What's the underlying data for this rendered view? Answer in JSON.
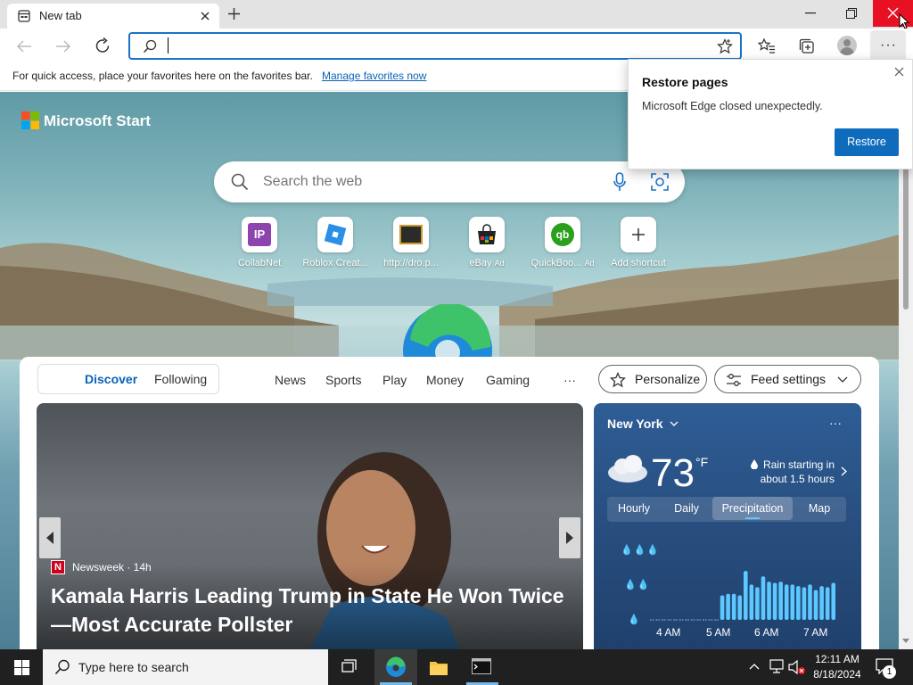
{
  "browser": {
    "tab_title": "New tab",
    "address_value": "",
    "favorites_bar_text": "For quick access, place your favorites here on the favorites bar.",
    "favorites_bar_link": "Manage favorites now"
  },
  "popup": {
    "title": "Restore pages",
    "message": "Microsoft Edge closed unexpectedly.",
    "restore_label": "Restore"
  },
  "start": {
    "brand": "Microsoft Start",
    "search_placeholder": "Search the web",
    "shortcuts": [
      {
        "label": "CollabNet",
        "icon": "collabnet-icon",
        "ad": ""
      },
      {
        "label": "Roblox Creat...",
        "icon": "roblox-icon",
        "ad": ""
      },
      {
        "label": "http://dro.p...",
        "icon": "dropbox-like-icon",
        "ad": ""
      },
      {
        "label": "eBay",
        "icon": "ebay-icon",
        "ad": "Ad"
      },
      {
        "label": "QuickBoo...",
        "icon": "quickbooks-icon",
        "ad": "Ad"
      },
      {
        "label": "Add shortcut",
        "icon": "plus-icon",
        "ad": ""
      }
    ]
  },
  "feed": {
    "pill_tabs": [
      "Discover",
      "Following"
    ],
    "nav": [
      "News",
      "Sports",
      "Play",
      "Money",
      "Gaming"
    ],
    "more": "···",
    "personalize": "Personalize",
    "feed_settings": "Feed settings",
    "article": {
      "source": "Newsweek · 14h",
      "headline_line1": "Kamala Harris Leading Trump in State He Won Twice",
      "headline_line2": "—Most Accurate Pollster"
    }
  },
  "weather": {
    "location": "New York",
    "more": "···",
    "temp": "73",
    "unit": "°F",
    "rain_line1": "Rain starting in",
    "rain_line2": "about 1.5 hours",
    "tabs": [
      "Hourly",
      "Daily",
      "Precipitation",
      "Map"
    ],
    "times": [
      "4 AM",
      "5 AM",
      "6 AM",
      "7 AM"
    ],
    "chart_data": {
      "type": "bar",
      "values": [
        0,
        0,
        0,
        0,
        0,
        0,
        0,
        0,
        0,
        0,
        0,
        0,
        0.45,
        0.48,
        0.48,
        0.45,
        0.9,
        0.65,
        0.6,
        0.8,
        0.7,
        0.68,
        0.7,
        0.65,
        0.65,
        0.62,
        0.6,
        0.65,
        0.55,
        0.62,
        0.6,
        0.68
      ]
    }
  },
  "taskbar": {
    "search_placeholder": "Type here to search",
    "time": "12:11 AM",
    "date": "8/18/2024",
    "notifications": "1"
  }
}
